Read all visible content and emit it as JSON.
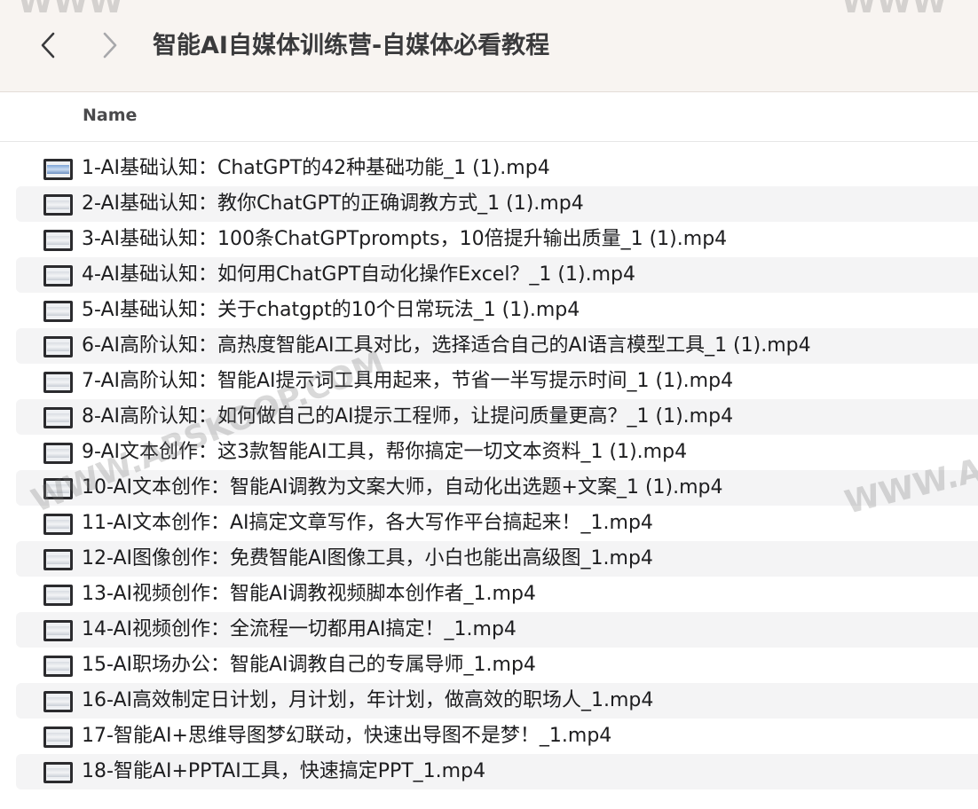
{
  "window": {
    "title": "智能AI自媒体训练营-自媒体必看教程",
    "back_icon": "chevron-left-icon",
    "forward_icon": "chevron-right-icon"
  },
  "column_header": {
    "name": "Name"
  },
  "files": [
    {
      "name": "1-AI基础认知：ChatGPT的42种基础功能_1 (1).mp4",
      "icon": "video-file-icon"
    },
    {
      "name": "2-AI基础认知：教你ChatGPT的正确调教方式_1 (1).mp4",
      "icon": "video-file-icon"
    },
    {
      "name": "3-AI基础认知：100条ChatGPTprompts，10倍提升输出质量_1 (1).mp4",
      "icon": "video-file-icon"
    },
    {
      "name": "4-AI基础认知：如何用ChatGPT自动化操作Excel？_1 (1).mp4",
      "icon": "video-file-icon"
    },
    {
      "name": "5-AI基础认知：关于chatgpt的10个日常玩法_1 (1).mp4",
      "icon": "video-file-icon"
    },
    {
      "name": "6-AI高阶认知：高热度智能AI工具对比，选择适合自己的AI语言模型工具_1 (1).mp4",
      "icon": "video-file-icon"
    },
    {
      "name": "7-AI高阶认知：智能AI提示词工具用起来，节省一半写提示时间_1 (1).mp4",
      "icon": "video-file-icon"
    },
    {
      "name": "8-AI高阶认知：如何做自己的AI提示工程师，让提问质量更高？_1 (1).mp4",
      "icon": "video-file-icon"
    },
    {
      "name": "9-AI文本创作：这3款智能AI工具，帮你搞定一切文本资料_1 (1).mp4",
      "icon": "video-file-icon"
    },
    {
      "name": "10-AI文本创作：智能AI调教为文案大师，自动化出选题+文案_1 (1).mp4",
      "icon": "video-file-icon"
    },
    {
      "name": "11-AI文本创作：AI搞定文章写作，各大写作平台搞起来！_1.mp4",
      "icon": "video-file-icon"
    },
    {
      "name": "12-AI图像创作：免费智能AI图像工具，小白也能出高级图_1.mp4",
      "icon": "video-file-icon"
    },
    {
      "name": "13-AI视频创作：智能AI调教视频脚本创作者_1.mp4",
      "icon": "video-file-icon"
    },
    {
      "name": "14-AI视频创作：全流程一切都用AI搞定！_1.mp4",
      "icon": "video-file-icon"
    },
    {
      "name": "15-AI职场办公：智能AI调教自己的专属导师_1.mp4",
      "icon": "video-file-icon"
    },
    {
      "name": "16-AI高效制定日计划，月计划，年计划，做高效的职场人_1.mp4",
      "icon": "video-file-icon"
    },
    {
      "name": "17-智能AI+思维导图梦幻联动，快速出导图不是梦！_1.mp4",
      "icon": "video-file-icon"
    },
    {
      "name": "18-智能AI+PPTAI工具，快速搞定PPT_1.mp4",
      "icon": "video-file-icon"
    }
  ],
  "watermarks": {
    "top_left": "WWW",
    "top_right": "WWW",
    "middle": "WWW.ABSKOOP.COM",
    "right": "WWW.A"
  }
}
